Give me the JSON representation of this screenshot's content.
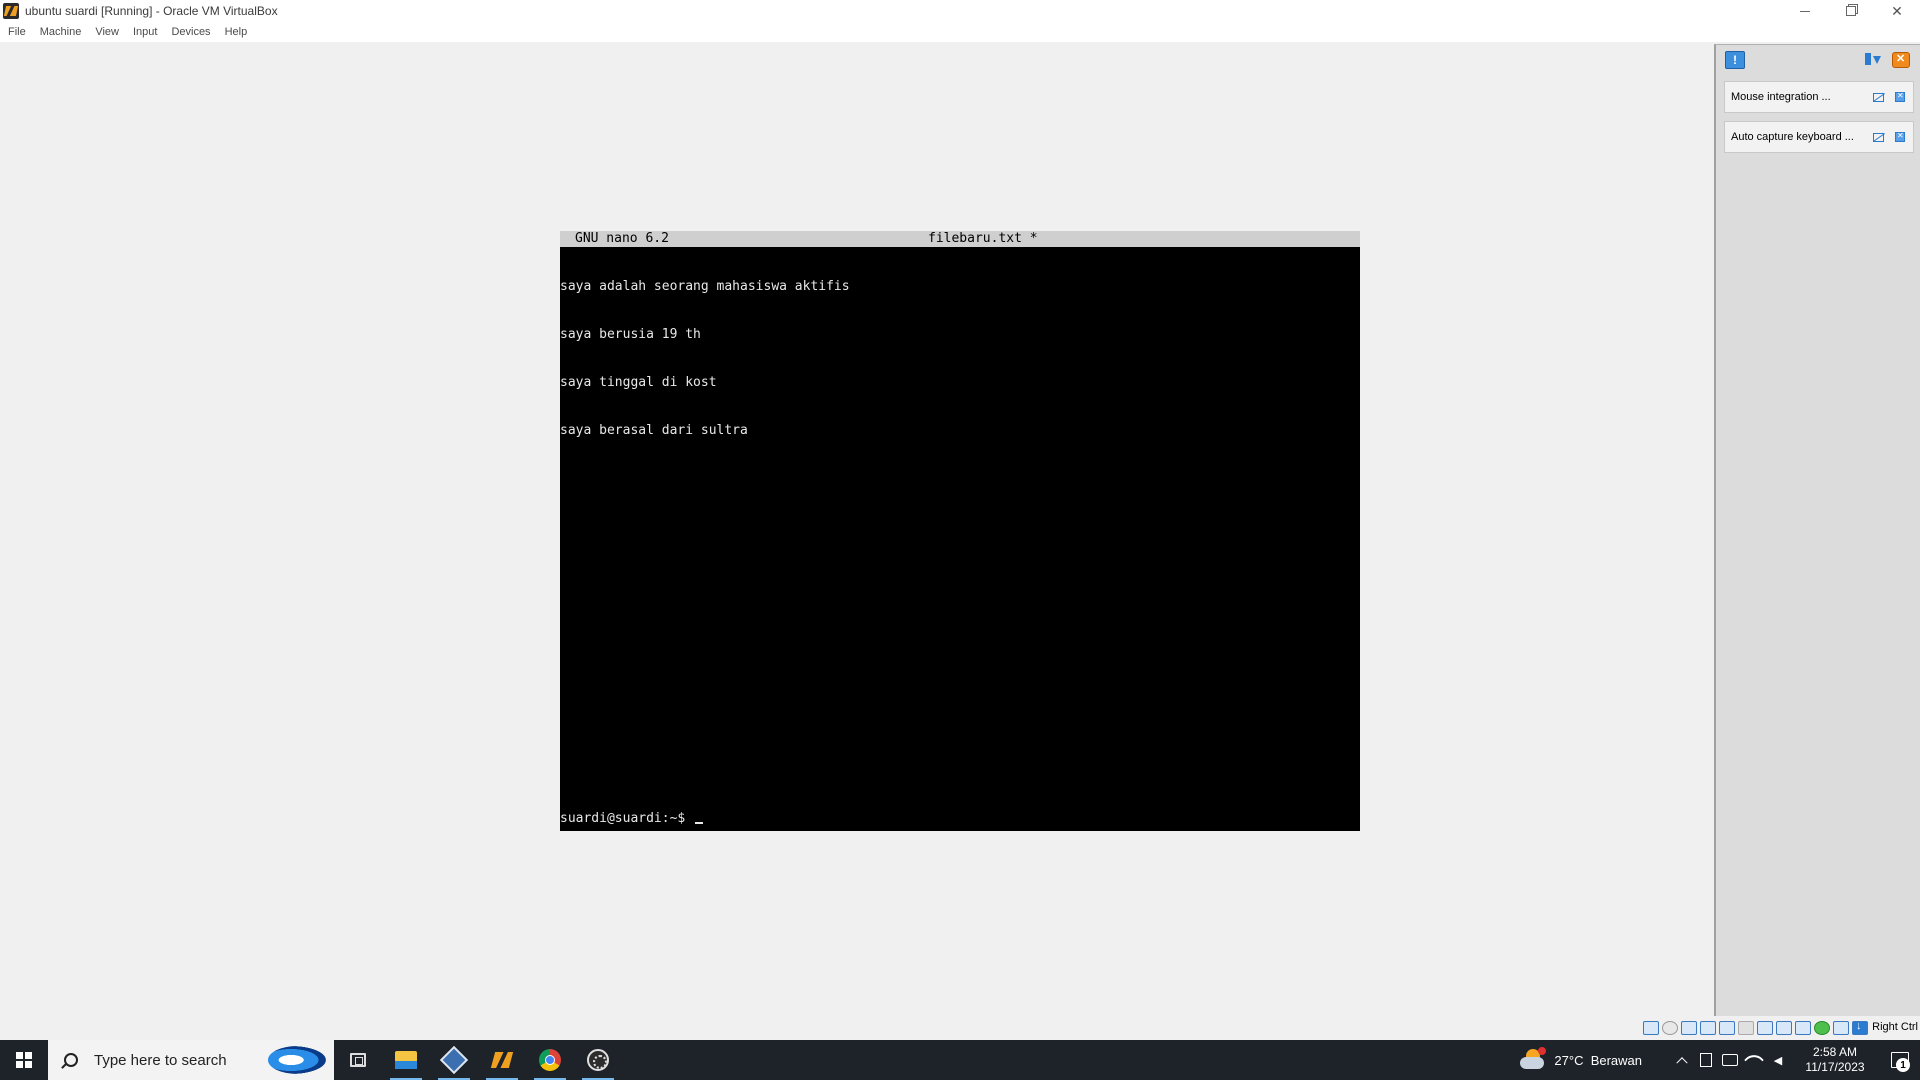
{
  "window": {
    "title": "ubuntu suardi [Running] - Oracle VM VirtualBox"
  },
  "menu": {
    "items": [
      "File",
      "Machine",
      "View",
      "Input",
      "Devices",
      "Help"
    ]
  },
  "terminal": {
    "nano_version": "GNU nano 6.2",
    "file_name": "filebaru.txt *",
    "lines": [
      "saya adalah seorang mahasiswa aktifis",
      "saya berusia 19 th",
      "saya tinggal di kost",
      "saya berasal dari sultra"
    ],
    "prompt": "suardi@suardi:~$ "
  },
  "notifications": {
    "items": [
      {
        "text": "Mouse integration ..."
      },
      {
        "text": "Auto capture keyboard ..."
      }
    ]
  },
  "status_bar": {
    "host_key": "Right Ctrl",
    "icons": [
      "hard-disk-icon",
      "optical-drive-icon",
      "audio-icon",
      "network-icon",
      "usb-icon",
      "shared-folder-icon",
      "display-icon",
      "recording-icon",
      "cpu-icon",
      "guest-additions-icon",
      "mouse-integration-icon",
      "keyboard-icon"
    ]
  },
  "taskbar": {
    "search_placeholder": "Type here to search",
    "apps": [
      "file-explorer-icon",
      "virtualbox-manager-icon",
      "virtualbox-vm-icon",
      "chrome-icon",
      "obs-icon"
    ],
    "weather": {
      "temperature": "27°C",
      "condition": "Berawan"
    },
    "clock": {
      "time": "2:58 AM",
      "date": "11/17/2023"
    },
    "notification_count": "1"
  }
}
